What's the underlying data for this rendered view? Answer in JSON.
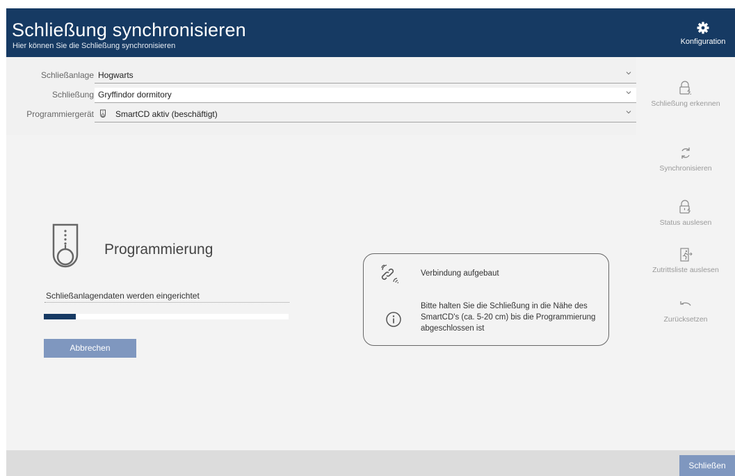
{
  "header": {
    "title": "Schließung synchronisieren",
    "subtitle": "Hier können Sie die Schließung synchronisieren",
    "config_label": "Konfiguration",
    "config_icon": "gear-icon",
    "bg_color": "#163a63"
  },
  "form": {
    "lock_system": {
      "label": "Schließanlage",
      "value": "Hogwarts"
    },
    "lock": {
      "label": "Schließung",
      "value": "Gryffindor dormitory"
    },
    "programming_device": {
      "label": "Programmiergerät",
      "value": "SmartCD aktiv (beschäftigt)",
      "icon": "smartcd-device-icon"
    }
  },
  "sidebar": {
    "items": [
      {
        "label": "Schließung erkennen",
        "icon": "lock-detect-icon"
      },
      {
        "label": "Synchronisieren",
        "icon": "sync-icon"
      },
      {
        "label": "Status auslesen",
        "icon": "lock-status-icon"
      },
      {
        "label": "Zutrittsliste auslesen",
        "icon": "access-list-icon"
      },
      {
        "label": "Zurücksetzen",
        "icon": "reset-icon"
      }
    ]
  },
  "main": {
    "title": "Programmierung",
    "status": "Schließanlagendaten werden eingerichtet",
    "progress": 0.13,
    "cancel_label": "Abbrechen"
  },
  "info_box": {
    "connection_text": "Verbindung aufgebaut",
    "instruction_text": "Bitte halten Sie die Schließung in die Nähe des SmartCD's (ca. 5-20 cm) bis die Programmierung abgeschlossen ist"
  },
  "footer": {
    "close_label": "Schließen",
    "button_color": "#7f97bf"
  }
}
